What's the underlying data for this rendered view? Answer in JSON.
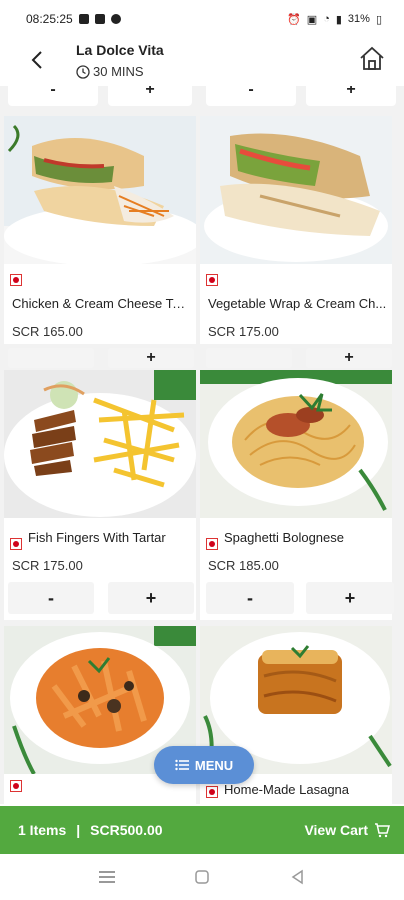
{
  "status_bar": {
    "time": "08:25:25",
    "battery": "31%"
  },
  "header": {
    "title": "La Dolce Vita",
    "delivery_time": "30 MINS"
  },
  "partial_row": {
    "minus": "-",
    "plus": "+"
  },
  "items": [
    {
      "name": "Chicken & Cream Cheese Tor...",
      "price": "SCR 165.00",
      "minus": "-",
      "plus": "+"
    },
    {
      "name": "Vegetable Wrap & Cream Ch...",
      "price": "SCR 175.00",
      "minus": "-",
      "plus": "+"
    },
    {
      "name": "Fish Fingers With Tartar",
      "price": "SCR 175.00",
      "minus": "-",
      "plus": "+"
    },
    {
      "name": "Spaghetti Bolognese",
      "price": "SCR 185.00",
      "minus": "-",
      "plus": "+"
    },
    {
      "name": "",
      "price": ""
    },
    {
      "name": "Home-Made Lasagna",
      "price": ""
    }
  ],
  "menu_fab": {
    "label": "MENU"
  },
  "cart": {
    "items": "1 Items",
    "separator": "|",
    "total": "SCR500.00",
    "view_cart": "View Cart"
  },
  "colors": {
    "accent": "#53a93f",
    "fab": "#5b8fd6",
    "non_veg": "#d0021b"
  }
}
